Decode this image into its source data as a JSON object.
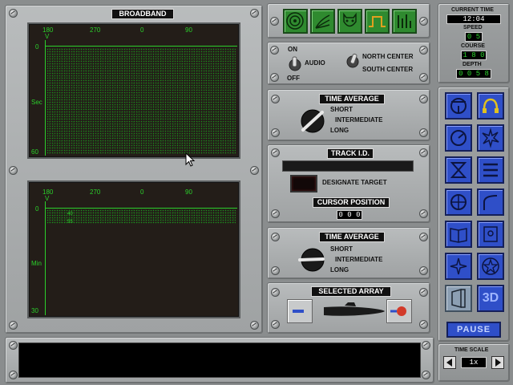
{
  "broadband": {
    "title": "BROADBAND",
    "upper": {
      "bearings": [
        "180",
        "270",
        "0",
        "90"
      ],
      "marker": "V",
      "y_top": "0",
      "y_mid": "Sec",
      "y_bot": "60"
    },
    "lower": {
      "bearings": [
        "180",
        "270",
        "0",
        "90"
      ],
      "marker": "V",
      "y_top": "0",
      "y_mid": "Min",
      "y_bot": "30",
      "blip1": "40",
      "blip2": "55"
    }
  },
  "audio": {
    "on": "ON",
    "off": "OFF",
    "label": "AUDIO",
    "north": "NORTH CENTER",
    "south": "SOUTH CENTER"
  },
  "time_average_1": {
    "title": "TIME AVERAGE",
    "short": "SHORT",
    "intermediate": "INTERMEDIATE",
    "long": "LONG"
  },
  "track_id": {
    "title": "TRACK I.D.",
    "designate": "DESIGNATE TARGET",
    "cursor_title": "CURSOR POSITION",
    "cursor_value": "0 0 0"
  },
  "time_average_2": {
    "title": "TIME AVERAGE",
    "short": "SHORT",
    "intermediate": "INTERMEDIATE",
    "long": "LONG"
  },
  "selected_array": {
    "title": "SELECTED ARRAY"
  },
  "status": {
    "current_time_label": "CURRENT TIME",
    "current_time": "12:04",
    "speed_label": "SPEED",
    "speed": "0 5",
    "course_label": "COURSE",
    "course": "1 8 0",
    "depth_label": "DEPTH",
    "depth": "0 0 5 8"
  },
  "pause_label": "PAUSE",
  "button_3d": "3D",
  "time_scale": {
    "label": "TIME SCALE",
    "value": "1x"
  },
  "colors": {
    "scope_green": "#2bd02b",
    "button_blue": "#2f4fc8",
    "button_green": "#2f8a2f",
    "active_orange": "#e0a020"
  }
}
